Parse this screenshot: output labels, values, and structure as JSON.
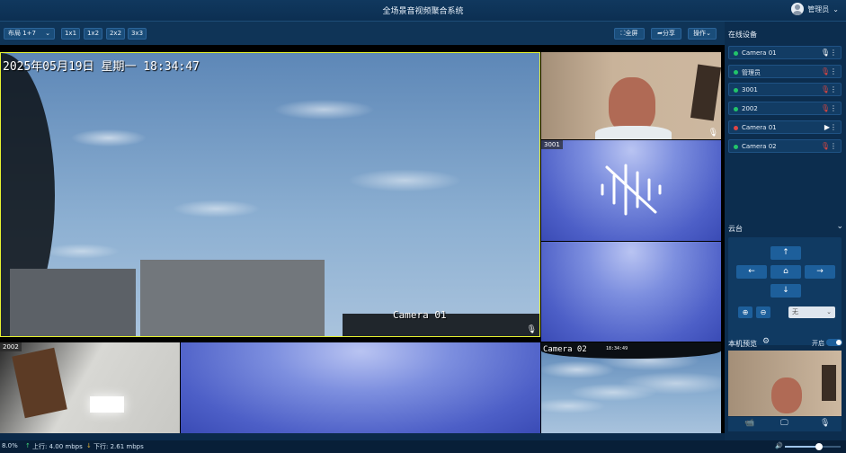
{
  "window": {
    "title": "全场景音视频聚合系统",
    "user": "管理员"
  },
  "toolbar": {
    "layout_select": "布局 1+7",
    "grid_options": [
      "1x1",
      "1x2",
      "2x2",
      "3x3"
    ],
    "fullscreen_label": "全屏",
    "share_label": "分享",
    "actions_label": "操作"
  },
  "videos": {
    "main": {
      "osd_time": "2025年05月19日 星期一 18:34:47",
      "osd_camera": "Camera 01"
    },
    "tile_3001": {
      "label": "3001"
    },
    "tile_2002": {
      "label": "2002"
    },
    "tile_cam02": {
      "osd_camera": "Camera 02",
      "osd_small": "18:34:49"
    }
  },
  "sidebar": {
    "online_title": "在线设备",
    "devices": [
      {
        "name": "Camera 01",
        "status": "online",
        "icon": "mic-icon"
      },
      {
        "name": "管理员",
        "status": "online",
        "icon": "mic-muted-icon"
      },
      {
        "name": "3001",
        "status": "online",
        "icon": "mic-muted-icon"
      },
      {
        "name": "2002",
        "status": "online",
        "icon": "mic-muted-icon"
      },
      {
        "name": "Camera 01",
        "status": "offline",
        "icon": "play-icon"
      },
      {
        "name": "Camera 02",
        "status": "online",
        "icon": "mic-muted-icon"
      }
    ],
    "ptz_title": "云台",
    "preset_placeholder": "无",
    "preview_title": "本机预览",
    "preview_toggle": "开启"
  },
  "status": {
    "percent": "8.0%",
    "upload": "上行: 4.00 mbps",
    "download": "下行: 2.61 mbps",
    "volume_level": 0.62
  },
  "colors": {
    "online": "#22c46a",
    "offline": "#e04545",
    "accent": "#1d5f9b",
    "highlight_border": "#e6f230",
    "muted": "#e0463f"
  }
}
